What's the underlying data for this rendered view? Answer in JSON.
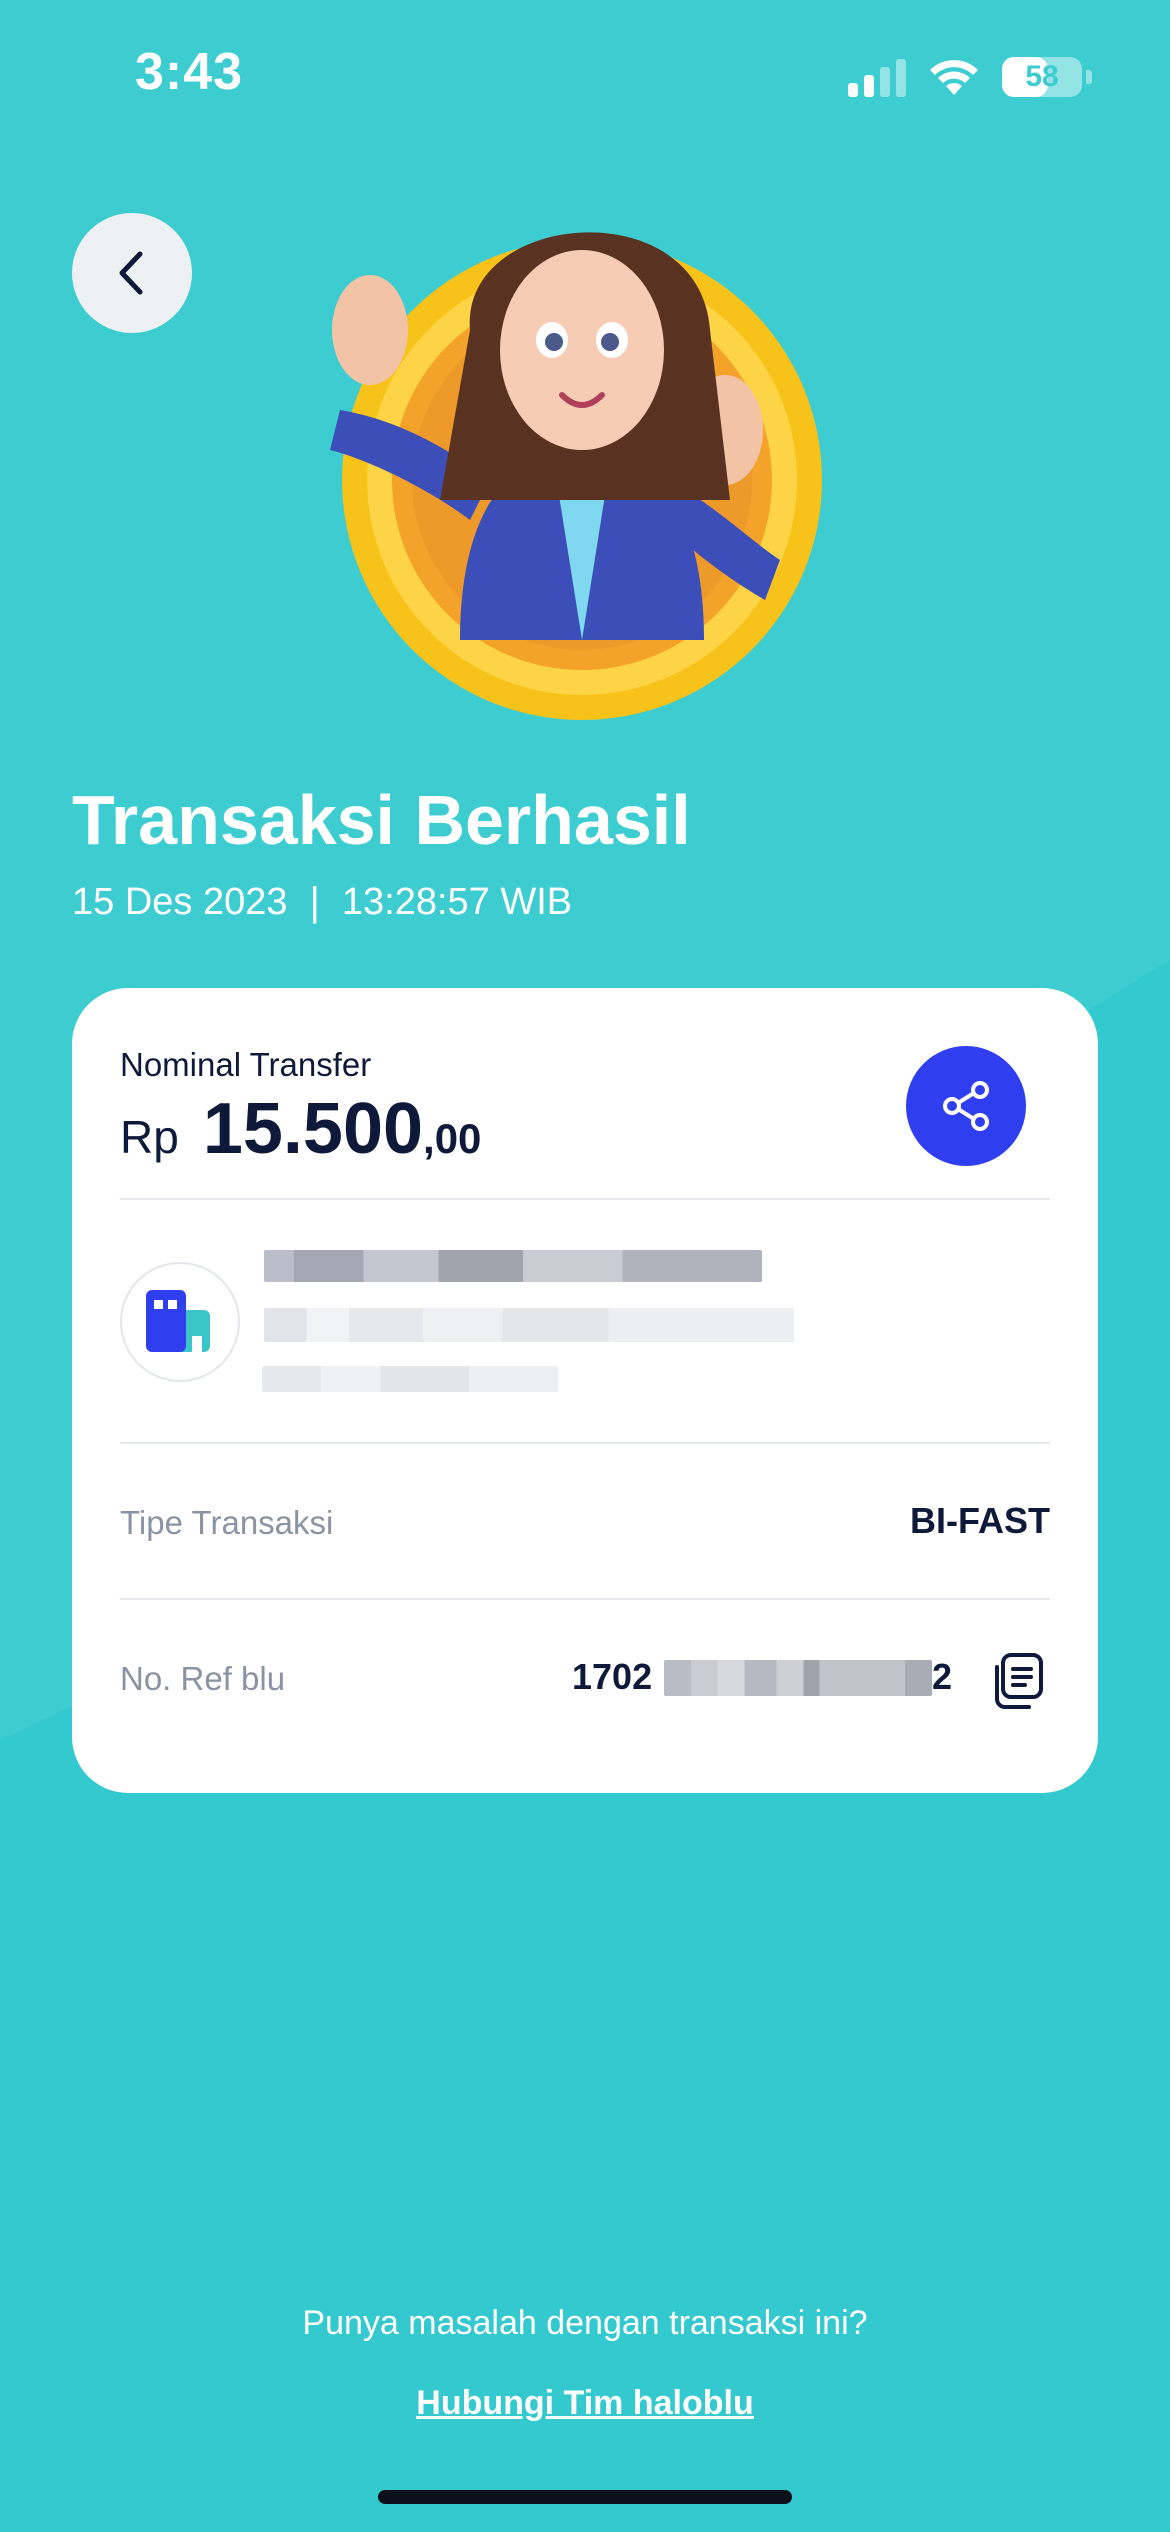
{
  "status_bar": {
    "time": "3:43",
    "battery_level": "58",
    "battery_fraction": 0.58,
    "signal_bars_active": 2,
    "signal_bars_total": 4
  },
  "header": {
    "back_icon": "chevron-left-icon",
    "hero_illustration": "woman-avatar-peace-sign-on-gold-coin"
  },
  "title": {
    "text": "Transaksi Berhasil",
    "date": "15 Des 2023",
    "separator": "|",
    "time": "13:28:57 WIB"
  },
  "card": {
    "nominal_label": "Nominal Transfer",
    "currency": "Rp",
    "amount": "15.500",
    "amount_decimals": ",00",
    "share_icon": "share-icon",
    "recipient": {
      "bank_logo_icon": "bank-building-icon",
      "name": "[redacted]",
      "bank_account": "[redacted]",
      "extra": "[redacted]"
    },
    "transaction_type_label": "Tipe Transaksi",
    "transaction_type_value": "BI-FAST",
    "ref_label": "No. Ref blu",
    "ref_value_start": "1702",
    "ref_value_end": "2",
    "copy_icon": "copy-icon"
  },
  "footer": {
    "help_text": "Punya masalah dengan transaksi ini?",
    "help_link": "Hubungi Tim haloblu"
  },
  "colors": {
    "background": "#3dcdd0",
    "card": "#ffffff",
    "accent_blue": "#2f3ff0",
    "text_dark": "#0f1a3a",
    "text_muted": "#8a93a3"
  }
}
